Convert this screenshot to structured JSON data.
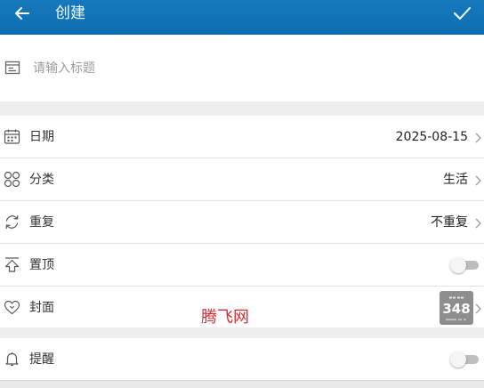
{
  "appbar": {
    "title": "创建",
    "back_icon": "back-arrow-icon",
    "confirm_icon": "check-icon"
  },
  "title_field": {
    "placeholder": "请输入标题",
    "value": "",
    "icon": "note-icon"
  },
  "rows": {
    "date": {
      "label": "日期",
      "value": "2025-08-15",
      "icon": "calendar-icon"
    },
    "category": {
      "label": "分类",
      "value": "生活",
      "icon": "category-icon"
    },
    "repeat": {
      "label": "重复",
      "value": "不重复",
      "icon": "repeat-icon"
    },
    "pin": {
      "label": "置顶",
      "enabled": false,
      "icon": "pin-top-icon"
    },
    "cover": {
      "label": "封面",
      "icon": "heart-icon",
      "thumb_number": "348"
    },
    "reminder": {
      "label": "提醒",
      "enabled": false,
      "icon": "bell-icon"
    }
  },
  "watermark": "腾飞网",
  "colors": {
    "appbar": "#1274b8",
    "toggle_off": "#bdbdbd",
    "watermark": "#d9282f"
  }
}
